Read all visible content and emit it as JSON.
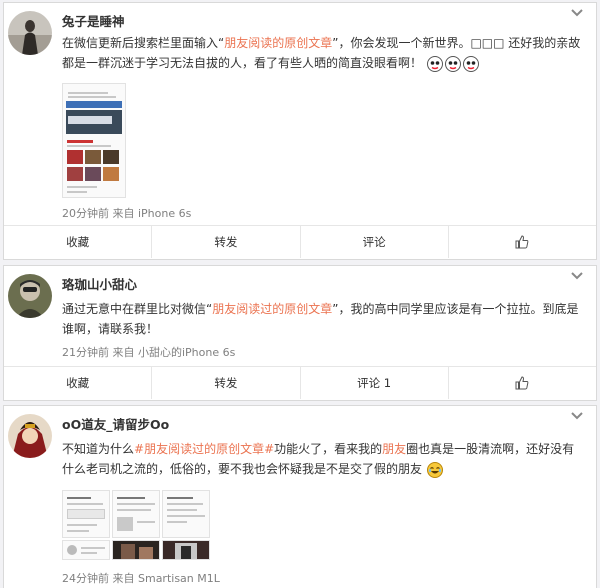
{
  "posts": [
    {
      "username": "兔子是睡神",
      "text_before": "在微信更新后搜索栏里面输入“",
      "text_highlight": "朋友阅读的原创文章",
      "text_after": "”，你会发现一个新世界。□□□ 还好我的亲故都是一群沉迷于学习无法自拔的人，看了有些人晒的简直没眼看啊！",
      "meta": "20分钟前 来自 iPhone 6s",
      "actions": {
        "collect": "收藏",
        "repost": "转发",
        "comment": "评论"
      }
    },
    {
      "username": "珞珈山小甜心",
      "text_before": "通过无意中在群里比对微信“",
      "text_highlight": "朋友阅读过的原创文章",
      "text_after": "”，我的高中同学里应该是有一个拉拉。到底是谁啊，请联系我！",
      "meta": "21分钟前 来自 小甜心的iPhone 6s",
      "actions": {
        "collect": "收藏",
        "repost": "转发",
        "comment": "评论 1"
      }
    },
    {
      "username": "oO道友_请留步Oo",
      "text_p1": "不知道为什么",
      "text_tag": "#朋友阅读过的原创文章#",
      "text_p2": "功能火了，看来我的",
      "text_friend": "朋友",
      "text_p3": "圈也真是一股清流啊，还好没有什么老司机之流的，低俗的，要不我也会怀疑我是不是交了假的朋友",
      "meta": "24分钟前 来自 Smartisan M1L"
    }
  ],
  "icons": {
    "chevron": "chevron-down-icon",
    "like": "thumbs-up-icon",
    "emoji": "emoji-icon"
  },
  "colors": {
    "highlight": "#eb7350",
    "meta": "#808080"
  }
}
